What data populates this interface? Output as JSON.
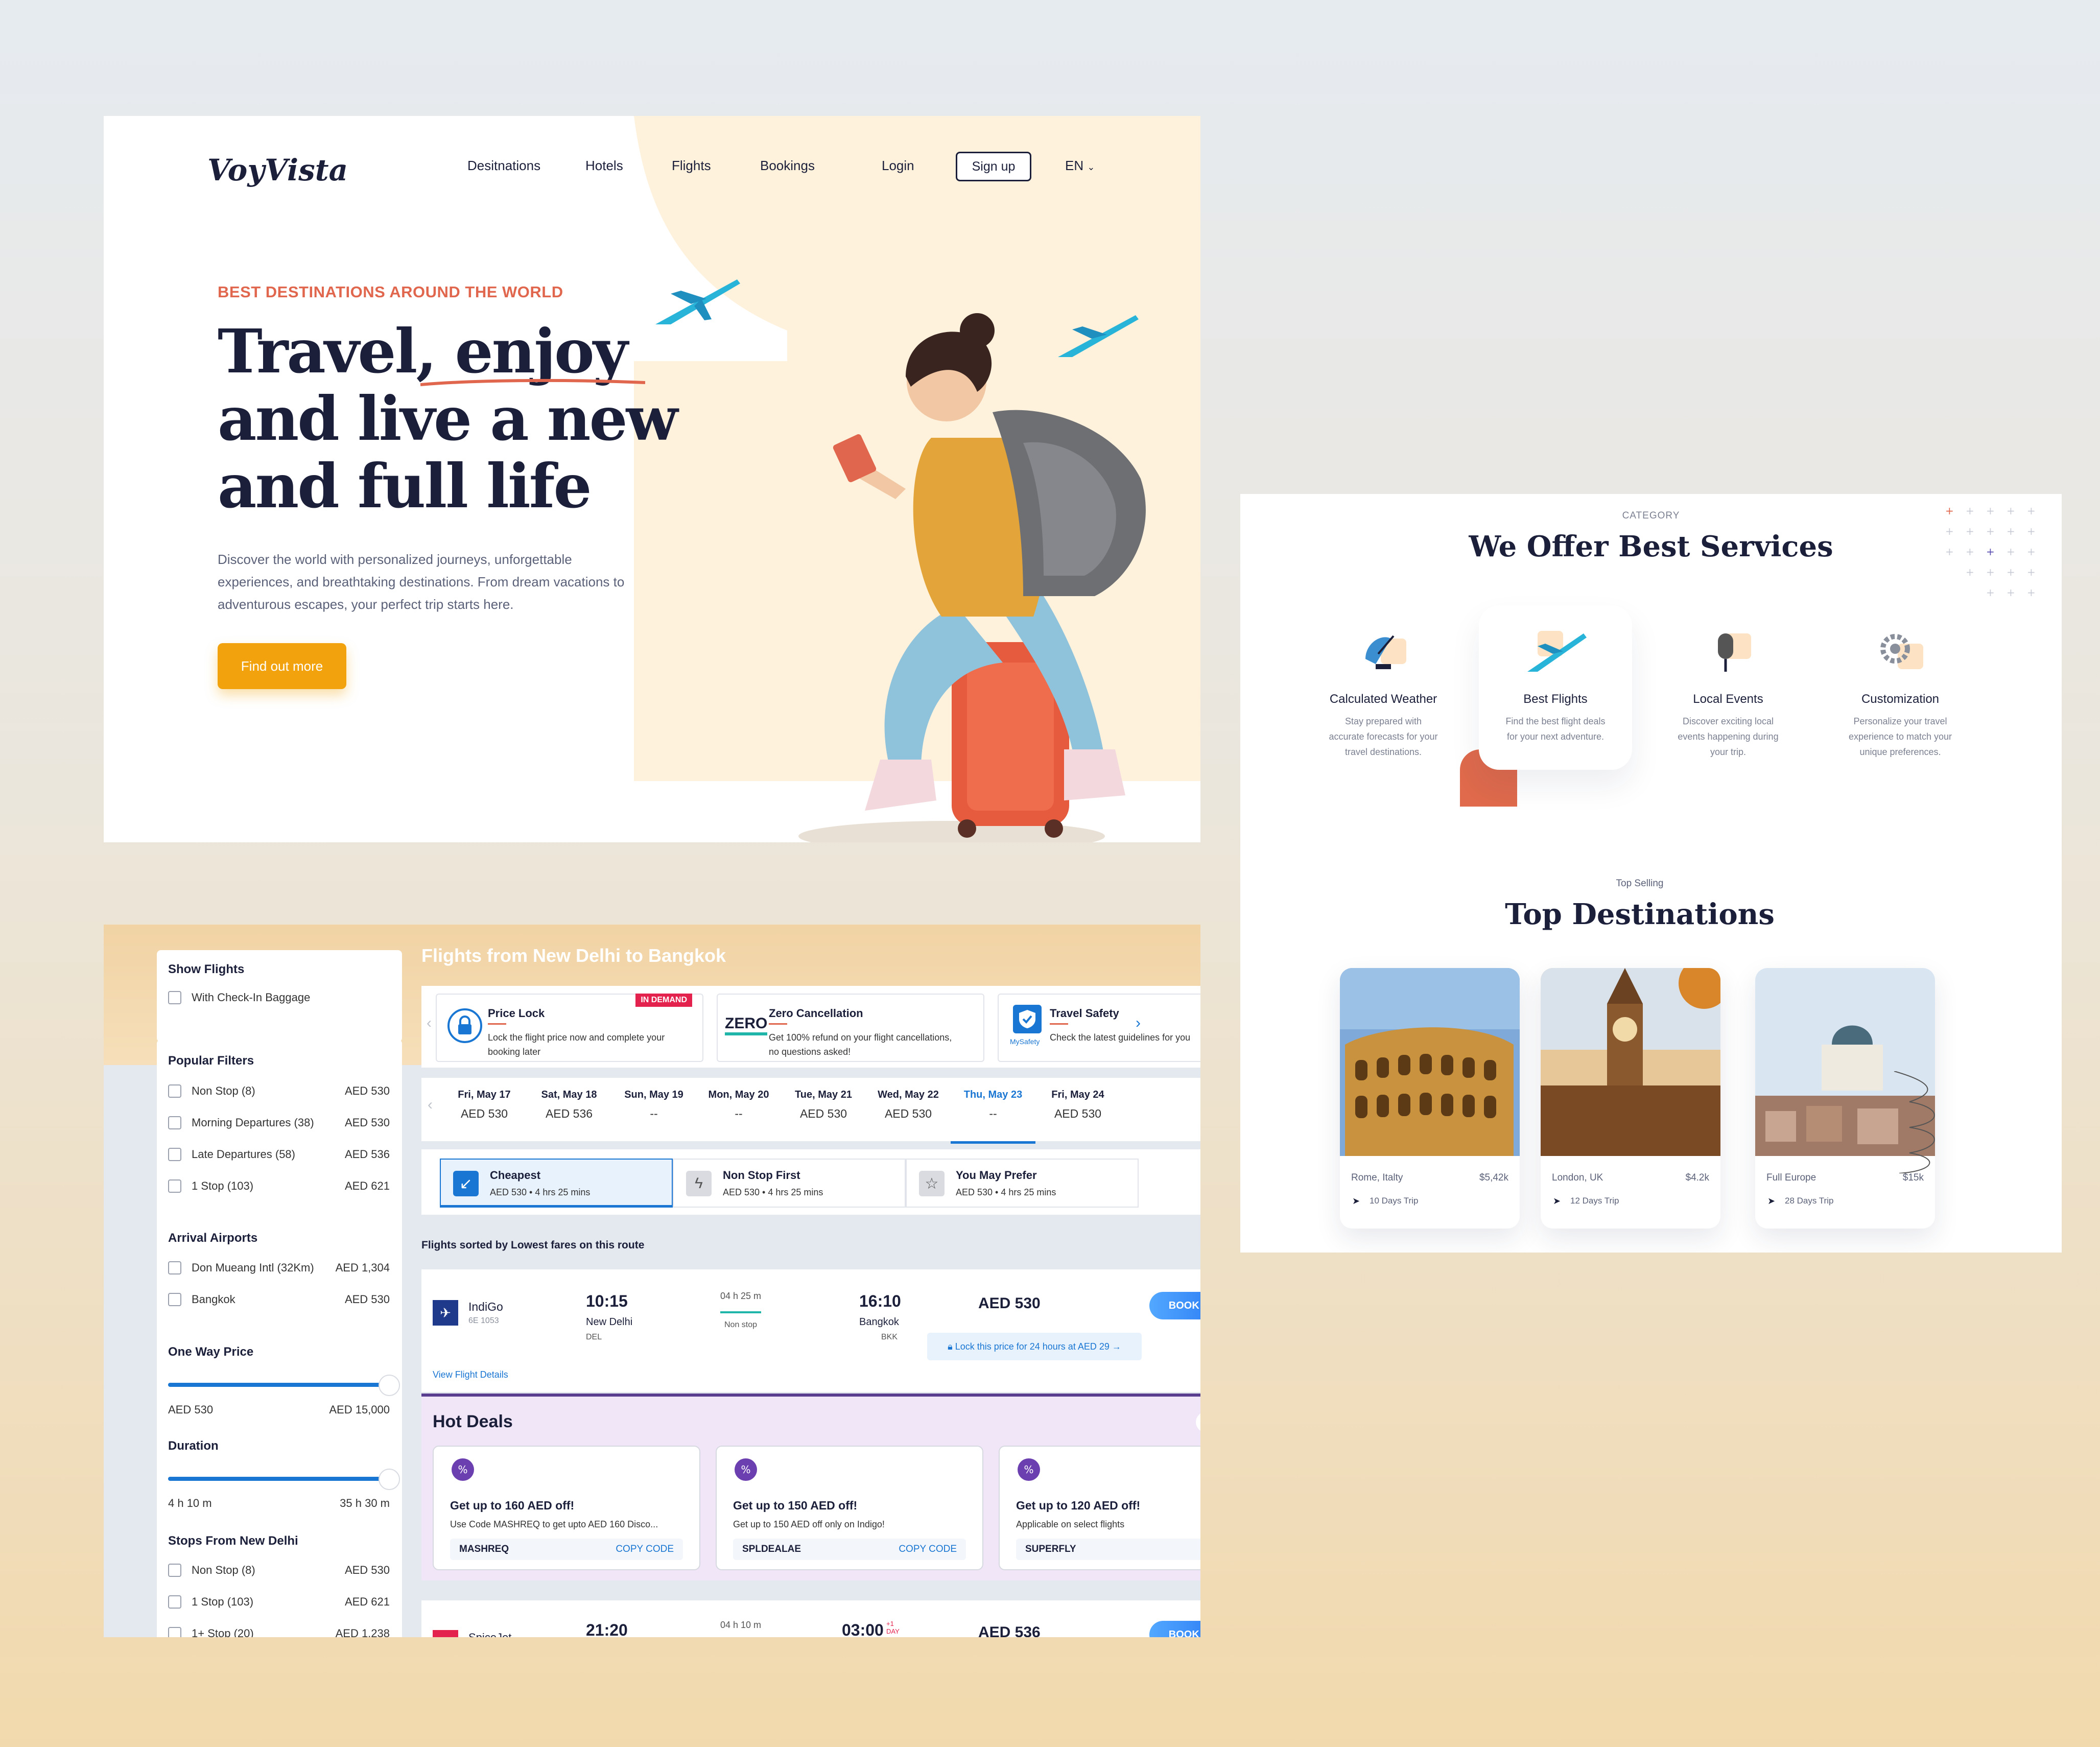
{
  "hero": {
    "logo": "VoyVista",
    "nav": [
      "Desitnations",
      "Hotels",
      "Flights",
      "Bookings"
    ],
    "login": "Login",
    "signup": "Sign up",
    "lang": "EN",
    "eyebrow": "BEST DESTINATIONS AROUND THE WORLD",
    "headline": "Travel, enjoy and live a new and full life",
    "description": "Discover the world with personalized journeys, unforgettable experiences, and breathtaking destinations. From dream vacations to adventurous escapes, your perfect trip starts here.",
    "cta": "Find out more"
  },
  "services": {
    "eyebrow": "CATEGORY",
    "title": "We Offer Best Services",
    "items": [
      {
        "name": "Calculated Weather",
        "desc": "Stay prepared with accurate forecasts for your travel destinations.",
        "icon": "satellite-icon"
      },
      {
        "name": "Best Flights",
        "desc": "Find the best flight deals for your next adventure.",
        "icon": "airplane-icon"
      },
      {
        "name": "Local Events",
        "desc": "Discover exciting local events happening during your trip.",
        "icon": "microphone-icon"
      },
      {
        "name": "Customization",
        "desc": "Personalize your travel experience to match your unique preferences.",
        "icon": "gear-icon"
      }
    ],
    "top_eyebrow": "Top Selling",
    "top_title": "Top Destinations",
    "destinations": [
      {
        "place": "Rome, Italty",
        "price": "$5,42k",
        "trip": "10 Days Trip"
      },
      {
        "place": "London, UK",
        "price": "$4.2k",
        "trip": "12 Days Trip"
      },
      {
        "place": "Full Europe",
        "price": "$15k",
        "trip": "28 Days Trip"
      }
    ]
  },
  "flights": {
    "show_flights": "Show Flights",
    "checkin": "With Check-In Baggage",
    "popular_title": "Popular Filters",
    "popular": [
      {
        "label": "Non Stop (8)",
        "value": "AED 530"
      },
      {
        "label": "Morning Departures (38)",
        "value": "AED 530"
      },
      {
        "label": "Late Departures (58)",
        "value": "AED 536"
      },
      {
        "label": "1 Stop (103)",
        "value": "AED 621"
      }
    ],
    "arrival_title": "Arrival Airports",
    "arrival": [
      {
        "label": "Don Mueang Intl (32Km)",
        "value": "AED 1,304"
      },
      {
        "label": "Bangkok",
        "value": "AED 530"
      }
    ],
    "oneway_title": "One Way Price",
    "price_min": "AED 530",
    "price_max": "AED 15,000",
    "duration_title": "Duration",
    "dur_min": "4 h 10 m",
    "dur_max": "35 h 30 m",
    "stops_title": "Stops From New Delhi",
    "stops": [
      {
        "label": "Non Stop (8)",
        "value": "AED 530"
      },
      {
        "label": "1 Stop (103)",
        "value": "AED 621"
      },
      {
        "label": "1+ Stop (20)",
        "value": "AED 1,238"
      }
    ],
    "route_title": "Flights from New Delhi to Bangkok",
    "perks": [
      {
        "title": "Price Lock",
        "desc": "Lock the flight price now and complete your booking later",
        "badge": "IN DEMAND"
      },
      {
        "title": "Zero Cancellation",
        "desc": "Get 100% refund on your flight cancellations, no questions asked!",
        "logo": "ZERO"
      },
      {
        "title": "Travel Safety",
        "desc": "Check the latest guidelines for you",
        "logo": "MySafety"
      }
    ],
    "dates": [
      {
        "day": "Fri, May 17",
        "price": "AED 530"
      },
      {
        "day": "Sat, May 18",
        "price": "AED 536"
      },
      {
        "day": "Sun, May 19",
        "price": "--"
      },
      {
        "day": "Mon, May 20",
        "price": "--"
      },
      {
        "day": "Tue, May 21",
        "price": "AED 530"
      },
      {
        "day": "Wed, May 22",
        "price": "AED 530"
      },
      {
        "day": "Thu, May 23",
        "price": "--"
      },
      {
        "day": "Fri, May 24",
        "price": "AED 530"
      }
    ],
    "sorts": [
      {
        "title": "Cheapest",
        "sub": "AED 530  •  4 hrs 25 mins"
      },
      {
        "title": "Non Stop First",
        "sub": "AED 530  •  4 hrs 25 mins"
      },
      {
        "title": "You May Prefer",
        "sub": "AED 530  •  4 hrs 25 mins"
      }
    ],
    "sorted_note": "Flights sorted by Lowest fares on this route",
    "flight1": {
      "airline": "IndiGo",
      "code": "6E 1053",
      "dep_time": "10:15",
      "dep_city": "New Delhi",
      "dep_code": "DEL",
      "duration": "04 h 25 m",
      "stops": "Non stop",
      "arr_time": "16:10",
      "arr_city": "Bangkok",
      "arr_code": "BKK",
      "price": "AED 530",
      "book": "BOOK NOW",
      "lock": "Lock this price for 24 hours at AED 29 →",
      "details": "View Flight Details"
    },
    "hot_deals_title": "Hot Deals",
    "deals": [
      {
        "title": "Get up to 160 AED off!",
        "desc": "Use Code MASHREQ to get upto AED 160 Disco...",
        "code": "MASHREQ",
        "copy": "COPY CODE"
      },
      {
        "title": "Get up to 150 AED off!",
        "desc": "Get up to 150 AED off only on Indigo!",
        "code": "SPLDEALAE",
        "copy": "COPY CODE"
      },
      {
        "title": "Get up to 120 AED off!",
        "desc": "Applicable on select flights",
        "code": "SUPERFLY",
        "copy": ""
      }
    ],
    "flight2": {
      "airline": "SpiceJet",
      "dep_time": "21:20",
      "duration": "04 h 10 m",
      "arr_time": "03:00",
      "next_day": "+1 DAY",
      "price": "AED 536",
      "book": "BOOK NOW"
    }
  },
  "colors": {
    "accent": "#f2a20c",
    "navy": "#1b1f3a",
    "coral": "#e0674d",
    "blue": "#1976d2"
  }
}
